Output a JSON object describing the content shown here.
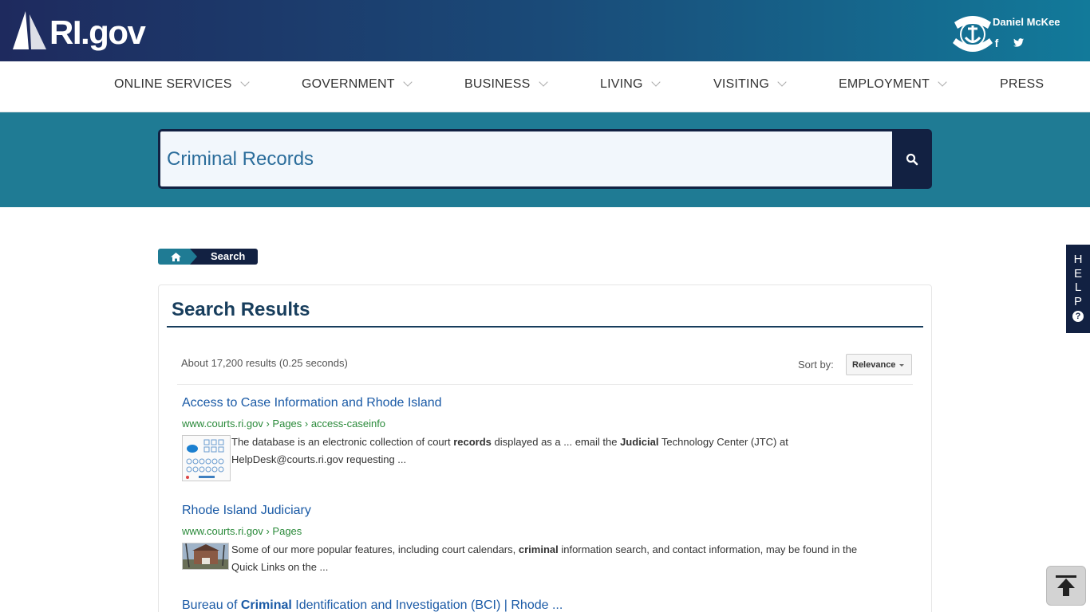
{
  "header": {
    "logo_text": "RI.gov",
    "governor_name": "Daniel McKee",
    "social": {
      "facebook": "f",
      "twitter": "twitter-icon"
    }
  },
  "nav": {
    "items": [
      {
        "label": "ONLINE SERVICES",
        "has_dropdown": true
      },
      {
        "label": "GOVERNMENT",
        "has_dropdown": true
      },
      {
        "label": "BUSINESS",
        "has_dropdown": true
      },
      {
        "label": "LIVING",
        "has_dropdown": true
      },
      {
        "label": "VISITING",
        "has_dropdown": true
      },
      {
        "label": "EMPLOYMENT",
        "has_dropdown": true
      },
      {
        "label": "PRESS",
        "has_dropdown": false
      }
    ]
  },
  "search": {
    "value": "Criminal Records",
    "button_icon": "search-icon"
  },
  "breadcrumb": {
    "home_icon": "home-icon",
    "current": "Search"
  },
  "results": {
    "heading": "Search Results",
    "count_text": "About 17,200 results (0.25 seconds)",
    "sort_label": "Sort by:",
    "sort_value": "Relevance",
    "items": [
      {
        "title_parts": [
          {
            "text": "Access to Case Information and Rhode Island",
            "bold": false
          }
        ],
        "url": "www.courts.ri.gov › Pages › access-caseinfo",
        "snippet_parts": [
          {
            "text": "The database is an electronic collection of court ",
            "bold": false
          },
          {
            "text": "records",
            "bold": true
          },
          {
            "text": " displayed as a ... email the ",
            "bold": false
          },
          {
            "text": "Judicial",
            "bold": true
          },
          {
            "text": " Technology Center (JTC) at HelpDesk@courts.ri.gov requesting ...",
            "bold": false
          }
        ]
      },
      {
        "title_parts": [
          {
            "text": "Rhode Island Judiciary",
            "bold": false
          }
        ],
        "url": "www.courts.ri.gov › Pages",
        "snippet_parts": [
          {
            "text": "Some of our more popular features, including court calendars, ",
            "bold": false
          },
          {
            "text": "criminal",
            "bold": true
          },
          {
            "text": " information search, and contact information, may be found in the Quick Links on the ...",
            "bold": false
          }
        ]
      },
      {
        "title_parts": [
          {
            "text": "Bureau of ",
            "bold": false
          },
          {
            "text": "Criminal",
            "bold": true
          },
          {
            "text": " Identification and Investigation (BCI) | Rhode ...",
            "bold": false
          }
        ],
        "url": "",
        "snippet_parts": []
      }
    ]
  },
  "help": {
    "letters": [
      "H",
      "E",
      "L",
      "P"
    ],
    "icon_text": "?"
  },
  "back_to_top": {
    "icon": "arrow-up-icon"
  },
  "colors": {
    "header_start": "#1e2a5e",
    "header_end": "#127a9a",
    "teal": "#1f7b94",
    "navy": "#122142",
    "link": "#1a5aa6",
    "url_green": "#2a8a3a"
  }
}
